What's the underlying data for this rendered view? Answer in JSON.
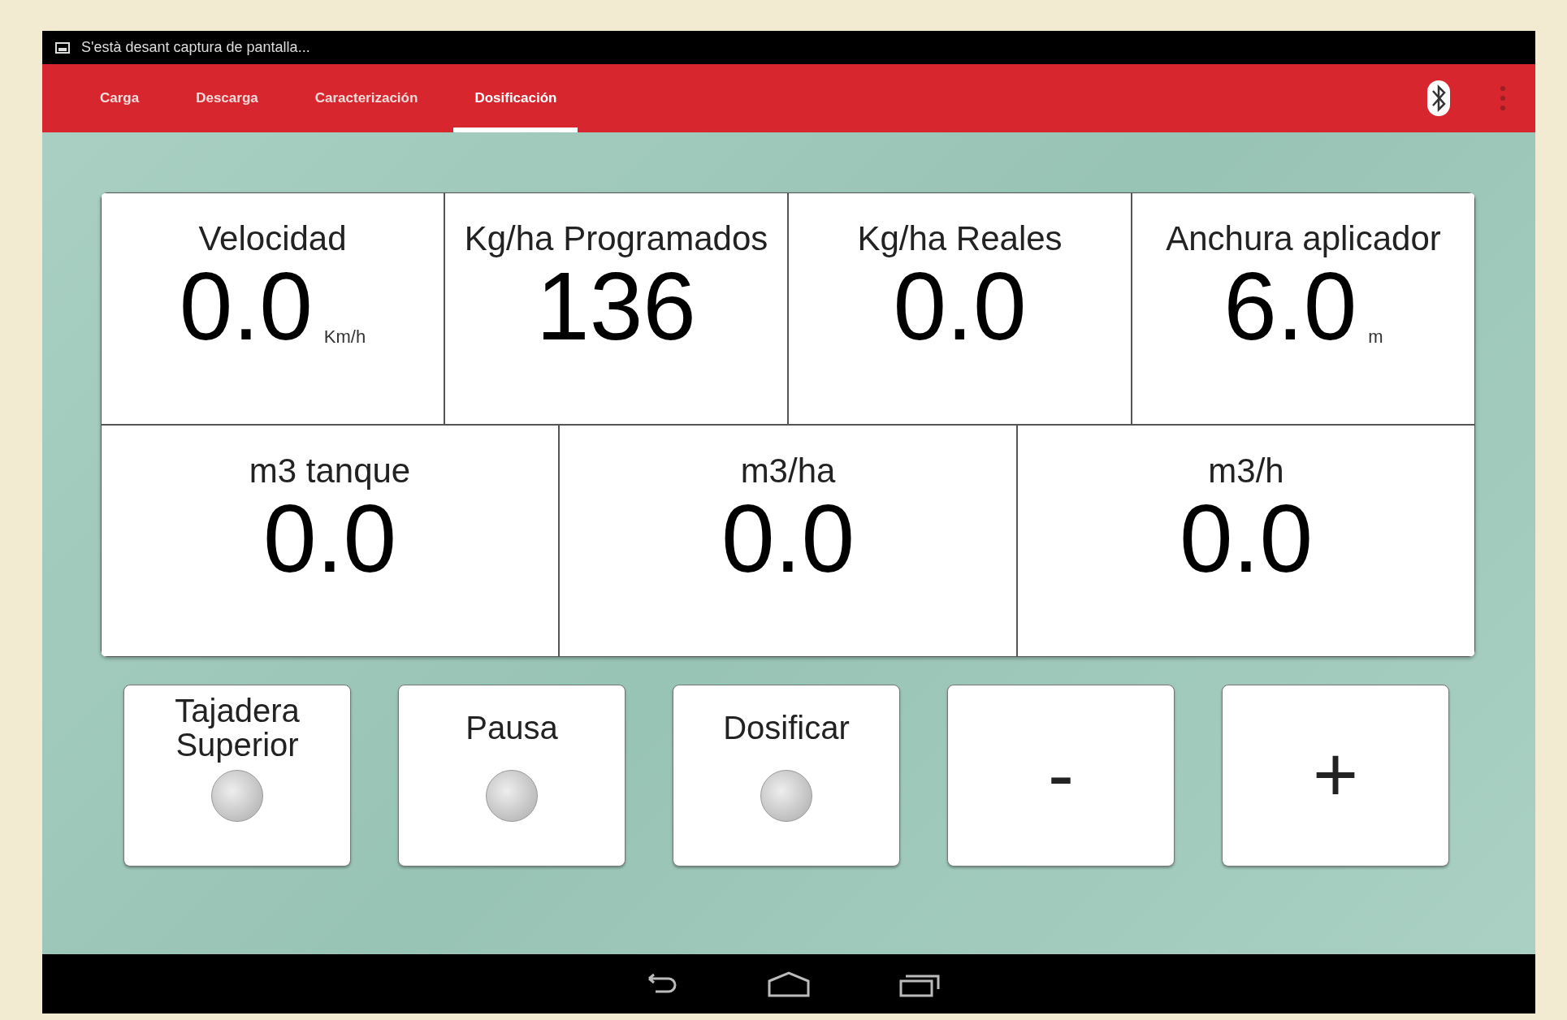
{
  "status_bar": {
    "notification": "S'està desant captura de pantalla..."
  },
  "tabs": [
    {
      "label": "Carga",
      "selected": false
    },
    {
      "label": "Descarga",
      "selected": false
    },
    {
      "label": "Caracterización",
      "selected": false
    },
    {
      "label": "Dosificación",
      "selected": true
    }
  ],
  "readings_top": [
    {
      "label": "Velocidad",
      "value": "0.0",
      "unit": "Km/h"
    },
    {
      "label": "Kg/ha Programados",
      "value": "136"
    },
    {
      "label": "Kg/ha Reales",
      "value": "0.0"
    },
    {
      "label": "Anchura aplicador",
      "value": "6.0",
      "unit": "m"
    }
  ],
  "readings_bottom": [
    {
      "label": "m3 tanque",
      "value": "0.0"
    },
    {
      "label": "m3/ha",
      "value": "0.0"
    },
    {
      "label": "m3/h",
      "value": "0.0"
    }
  ],
  "controls": [
    {
      "kind": "toggle",
      "label": "Tajadera Superior",
      "on": false
    },
    {
      "kind": "toggle",
      "label": "Pausa",
      "on": false
    },
    {
      "kind": "toggle",
      "label": "Dosificar",
      "on": false
    },
    {
      "kind": "step",
      "label": "-"
    },
    {
      "kind": "step",
      "label": "+"
    }
  ]
}
